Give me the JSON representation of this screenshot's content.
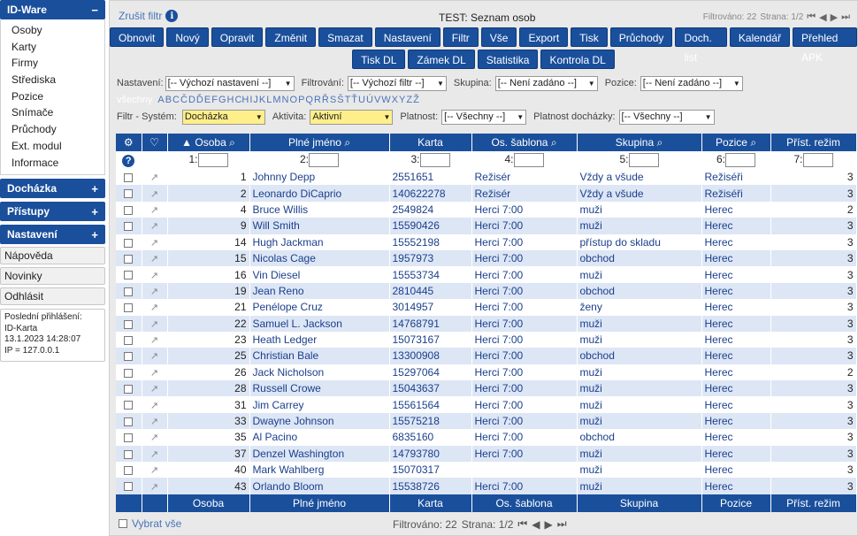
{
  "sidebar": {
    "app_title": "ID-Ware",
    "app_toggle": "−",
    "items": [
      "Osoby",
      "Karty",
      "Firmy",
      "Střediska",
      "Pozice",
      "Snímače",
      "Průchody",
      "Ext. modul",
      "Informace"
    ],
    "sections": [
      {
        "label": "Docházka",
        "toggle": "+"
      },
      {
        "label": "Přístupy",
        "toggle": "+"
      },
      {
        "label": "Nastavení",
        "toggle": "+"
      }
    ],
    "buttons": [
      "Nápověda",
      "Novinky",
      "Odhlásit"
    ],
    "info": {
      "line1": "Poslední přihlášení:",
      "line2": "ID-Karta",
      "line3": "13.1.2023 14:28:07",
      "line4": "IP = 127.0.0.1"
    }
  },
  "topbar": {
    "clear_filter": "Zrušit filtr",
    "title": "TEST: Seznam osob",
    "filtered": "Filtrováno: 22",
    "page": "Strana: 1/2"
  },
  "toolbar": {
    "row1": [
      "Obnovit",
      "Nový",
      "Opravit",
      "Změnit",
      "Smazat",
      "Nastavení",
      "Filtr",
      "Vše",
      "Export",
      "Tisk",
      "Průchody",
      "Doch. list",
      "Kalendář",
      "Přehled APK"
    ],
    "row2": [
      "Tisk DL",
      "Zámek DL",
      "Statistika",
      "Kontrola DL"
    ]
  },
  "filters": {
    "nastaveni_label": "Nastavení:",
    "nastaveni_value": "[-- Výchozí nastavení --]",
    "filtrovani_label": "Filtrování:",
    "filtrovani_value": "[-- Výchozí filtr --]",
    "skupina_label": "Skupina:",
    "skupina_value": "[-- Není zadáno --]",
    "pozice_label": "Pozice:",
    "pozice_value": "[-- Není zadáno --]",
    "system_label": "Filtr - Systém:",
    "system_value": "Docházka",
    "aktivita_label": "Aktivita:",
    "aktivita_value": "Aktivní",
    "platnost_label": "Platnost:",
    "platnost_value": "[-- Všechny --]",
    "platnost_doch_label": "Platnost docházky:",
    "platnost_doch_value": "[-- Všechny --]"
  },
  "alphabet": {
    "all": "všechny",
    "letters": [
      "A",
      "B",
      "C",
      "Č",
      "D",
      "Ď",
      "E",
      "F",
      "G",
      "H",
      "CH",
      "I",
      "J",
      "K",
      "L",
      "M",
      "N",
      "O",
      "P",
      "Q",
      "R",
      "Ř",
      "S",
      "Š",
      "T",
      "Ť",
      "U",
      "Ú",
      "V",
      "W",
      "X",
      "Y",
      "Z",
      "Ž"
    ]
  },
  "table": {
    "headers": [
      "Osoba",
      "Plné jméno",
      "Karta",
      "Os. šablona",
      "Skupina",
      "Pozice",
      "Příst. režim"
    ],
    "filter_prefixes": [
      "1:",
      "2:",
      "3:",
      "4:",
      "5:",
      "6:",
      "7:"
    ],
    "rows": [
      [
        "1",
        "Johnny Depp",
        "2551651",
        "Režisér",
        "Vždy a všude",
        "Režiséři",
        "3"
      ],
      [
        "2",
        "Leonardo DiCaprio",
        "140622278",
        "Režisér",
        "Vždy a všude",
        "Režiséři",
        "3"
      ],
      [
        "4",
        "Bruce Willis",
        "2549824",
        "Herci 7:00",
        "muži",
        "Herec",
        "2"
      ],
      [
        "9",
        "Will Smith",
        "15590426",
        "Herci 7:00",
        "muži",
        "Herec",
        "3"
      ],
      [
        "14",
        "Hugh Jackman",
        "15552198",
        "Herci 7:00",
        "přístup do skladu",
        "Herec",
        "3"
      ],
      [
        "15",
        "Nicolas Cage",
        "1957973",
        "Herci 7:00",
        "obchod",
        "Herec",
        "3"
      ],
      [
        "16",
        "Vin Diesel",
        "15553734",
        "Herci 7:00",
        "muži",
        "Herec",
        "3"
      ],
      [
        "19",
        "Jean Reno",
        "2810445",
        "Herci 7:00",
        "obchod",
        "Herec",
        "3"
      ],
      [
        "21",
        "Penélope Cruz",
        "3014957",
        "Herci 7:00",
        "ženy",
        "Herec",
        "3"
      ],
      [
        "22",
        "Samuel L. Jackson",
        "14768791",
        "Herci 7:00",
        "muži",
        "Herec",
        "3"
      ],
      [
        "23",
        "Heath Ledger",
        "15073167",
        "Herci 7:00",
        "muži",
        "Herec",
        "3"
      ],
      [
        "25",
        "Christian Bale",
        "13300908",
        "Herci 7:00",
        "obchod",
        "Herec",
        "3"
      ],
      [
        "26",
        "Jack Nicholson",
        "15297064",
        "Herci 7:00",
        "muži",
        "Herec",
        "2"
      ],
      [
        "28",
        "Russell Crowe",
        "15043637",
        "Herci 7:00",
        "muži",
        "Herec",
        "3"
      ],
      [
        "31",
        "Jim Carrey",
        "15561564",
        "Herci 7:00",
        "muži",
        "Herec",
        "3"
      ],
      [
        "33",
        "Dwayne Johnson",
        "15575218",
        "Herci 7:00",
        "muži",
        "Herec",
        "3"
      ],
      [
        "35",
        "Al Pacino",
        "6835160",
        "Herci 7:00",
        "obchod",
        "Herec",
        "3"
      ],
      [
        "37",
        "Denzel Washington",
        "14793780",
        "Herci 7:00",
        "muži",
        "Herec",
        "3"
      ],
      [
        "40",
        "Mark Wahlberg",
        "15070317",
        "",
        "muži",
        "Herec",
        "3"
      ],
      [
        "43",
        "Orlando Bloom",
        "15538726",
        "Herci 7:00",
        "muži",
        "Herec",
        "3"
      ]
    ]
  },
  "bottom": {
    "select_all": "Vybrat vše",
    "filtered": "Filtrováno: 22",
    "page": "Strana: 1/2"
  }
}
